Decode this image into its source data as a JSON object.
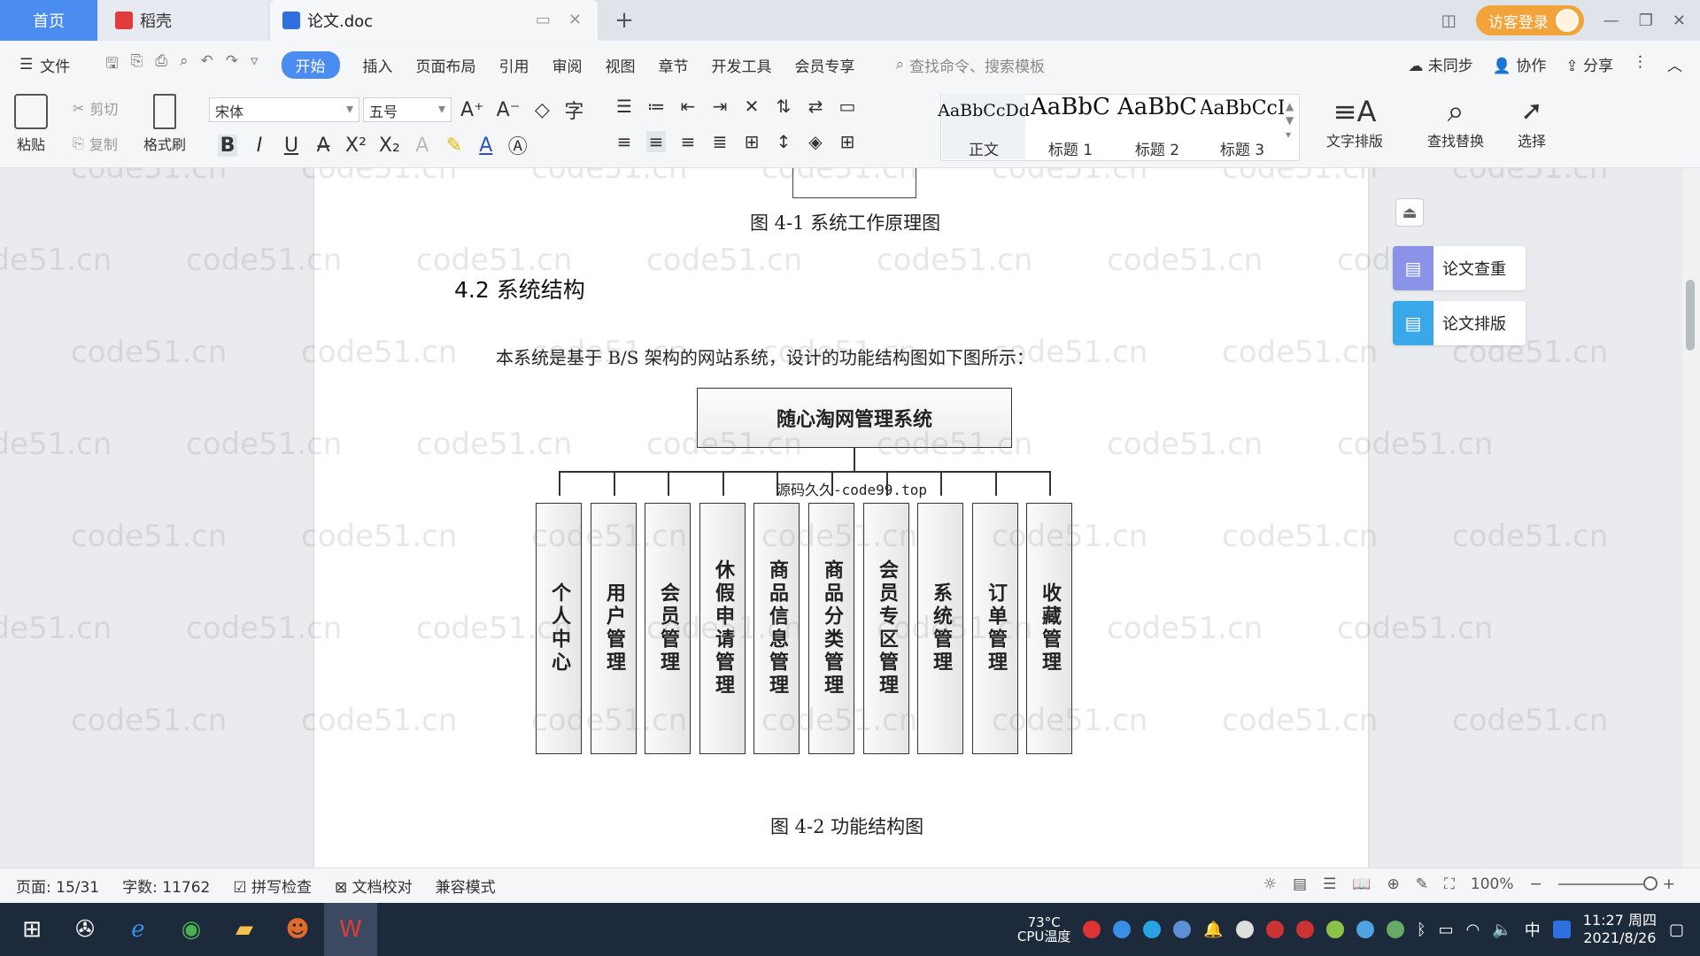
{
  "tabs": {
    "home": "首页",
    "daoke": "稻壳",
    "doc": "论文.doc"
  },
  "titlebar": {
    "guest_login": "访客登录"
  },
  "menu": {
    "file": "文件",
    "items": [
      "开始",
      "插入",
      "页面布局",
      "引用",
      "审阅",
      "视图",
      "章节",
      "开发工具",
      "会员专享"
    ],
    "search_placeholder": "查找命令、搜索模板",
    "unsynced": "未同步",
    "collab": "协作",
    "share": "分享"
  },
  "ribbon": {
    "paste": "粘贴",
    "cut": "剪切",
    "copy": "复制",
    "format_painter": "格式刷",
    "font": "宋体",
    "size": "五号",
    "styles": [
      {
        "sample": "AaBbCcDd",
        "name": "正文"
      },
      {
        "sample": "AaBbC",
        "name": "标题 1"
      },
      {
        "sample": "AaBbC",
        "name": "标题 2"
      },
      {
        "sample": "AaBbCcI",
        "name": "标题 3"
      }
    ],
    "text_layout": "文字排版",
    "find_replace": "查找替换",
    "select": "选择"
  },
  "document": {
    "caption_prev": "图 4-1 系统工作原理图",
    "heading": "4.2 系统结构",
    "paragraph": "本系统是基于 B/S 架构的网站系统，设计的功能结构图如下图所示：",
    "root": "随心淘网管理系统",
    "source_label": "源码久久-code99.top",
    "modules": [
      "个人中心",
      "用户管理",
      "会员管理",
      "休假申请管理",
      "商品信息管理",
      "商品分类管理",
      "会员专区管理",
      "系统管理",
      "订单管理",
      "收藏管理"
    ],
    "caption": "图 4-2 功能结构图",
    "watermark": "code51.cn"
  },
  "side_panel": {
    "check": "论文查重",
    "layout": "论文排版"
  },
  "status": {
    "page": "页面: 15/31",
    "words": "字数: 11762",
    "spell": "拼写检查",
    "proof": "文档校对",
    "compat": "兼容模式",
    "zoom": "100%",
    "zoom_level": 1.0
  },
  "taskbar": {
    "cpu_temp": "73°C",
    "cpu_label": "CPU温度",
    "ime": "中",
    "time": "11:27 周四",
    "date": "2021/8/26"
  },
  "colors": {
    "accent": "#4b8cf0",
    "guest": "#f2a33a",
    "taskbar": "#1d2a3b"
  }
}
